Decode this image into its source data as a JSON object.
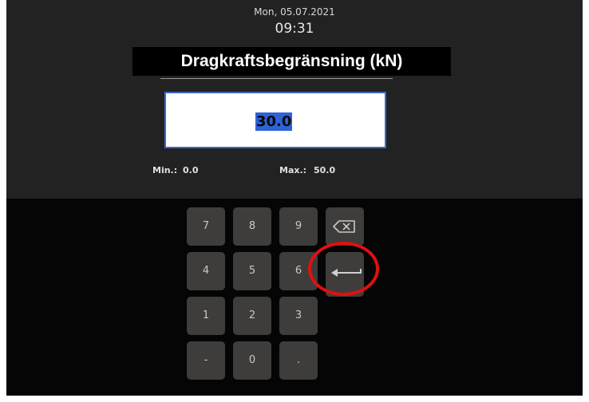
{
  "header": {
    "date": "Mon, 05.07.2021",
    "time": "09:31"
  },
  "dialog": {
    "title": "Dragkraftsbegränsning (kN)",
    "value": "30.0",
    "min_label": "Min.:",
    "min_value": "0.0",
    "max_label": "Max.:",
    "max_value": "50.0"
  },
  "keypad": {
    "keys": [
      "7",
      "8",
      "9",
      "4",
      "5",
      "6",
      "1",
      "2",
      "3",
      "-",
      "0",
      "."
    ],
    "backspace_icon": "backspace-icon",
    "enter_icon": "enter-icon"
  },
  "colors": {
    "background": "#050505",
    "panel": "#222222",
    "key": "#3e3d3b",
    "selection": "#2f62d6",
    "highlight_ring": "#e0100f"
  }
}
